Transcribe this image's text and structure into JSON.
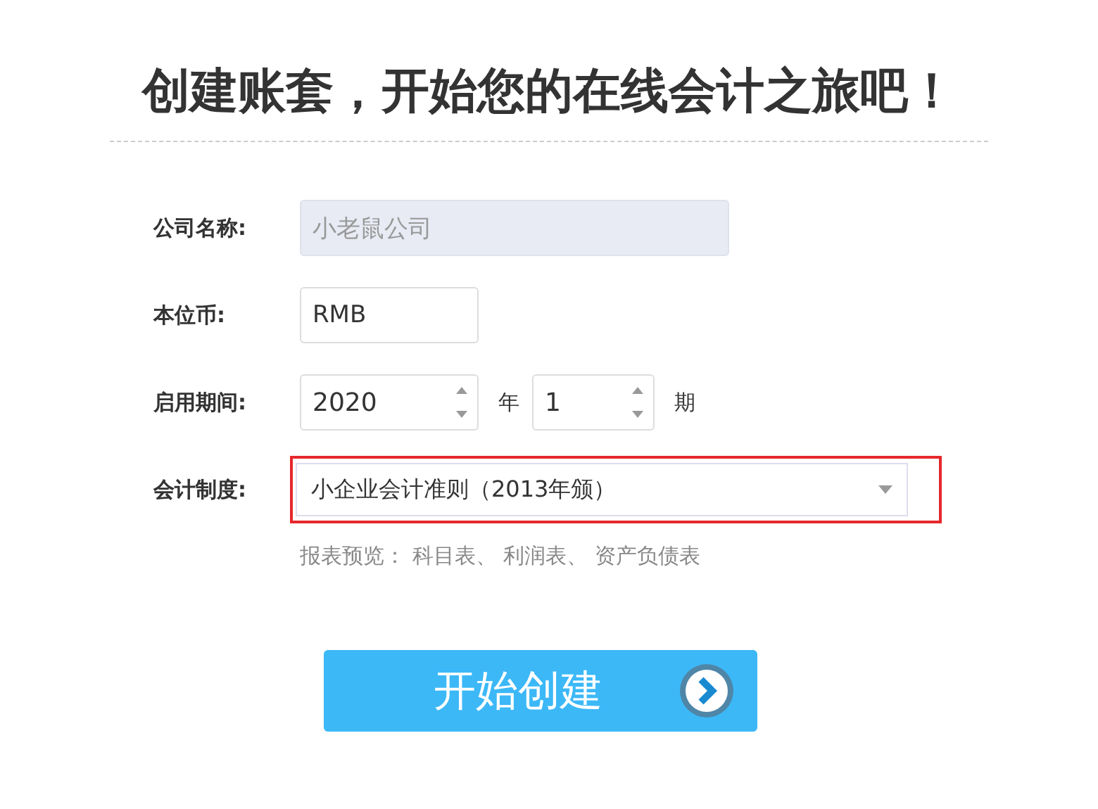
{
  "title": "创建账套，开始您的在线会计之旅吧！",
  "form": {
    "rows": [
      {
        "kind": "text",
        "label": "公司名称:",
        "value": "小老鼠公司",
        "disabled": true
      },
      {
        "kind": "text",
        "label": "本位币:",
        "value": "RMB",
        "disabled": false
      },
      {
        "kind": "period",
        "label": "启用期间:",
        "year": "2020",
        "year_unit": "年",
        "period": "1",
        "period_unit": "期"
      },
      {
        "kind": "select",
        "label": "会计制度:",
        "value": "小企业会计准则（2013年颁）",
        "highlighted": true
      }
    ],
    "preview": "报表预览： 科目表、 利润表、 资产负债表"
  },
  "submit_button": {
    "label": "开始创建"
  }
}
